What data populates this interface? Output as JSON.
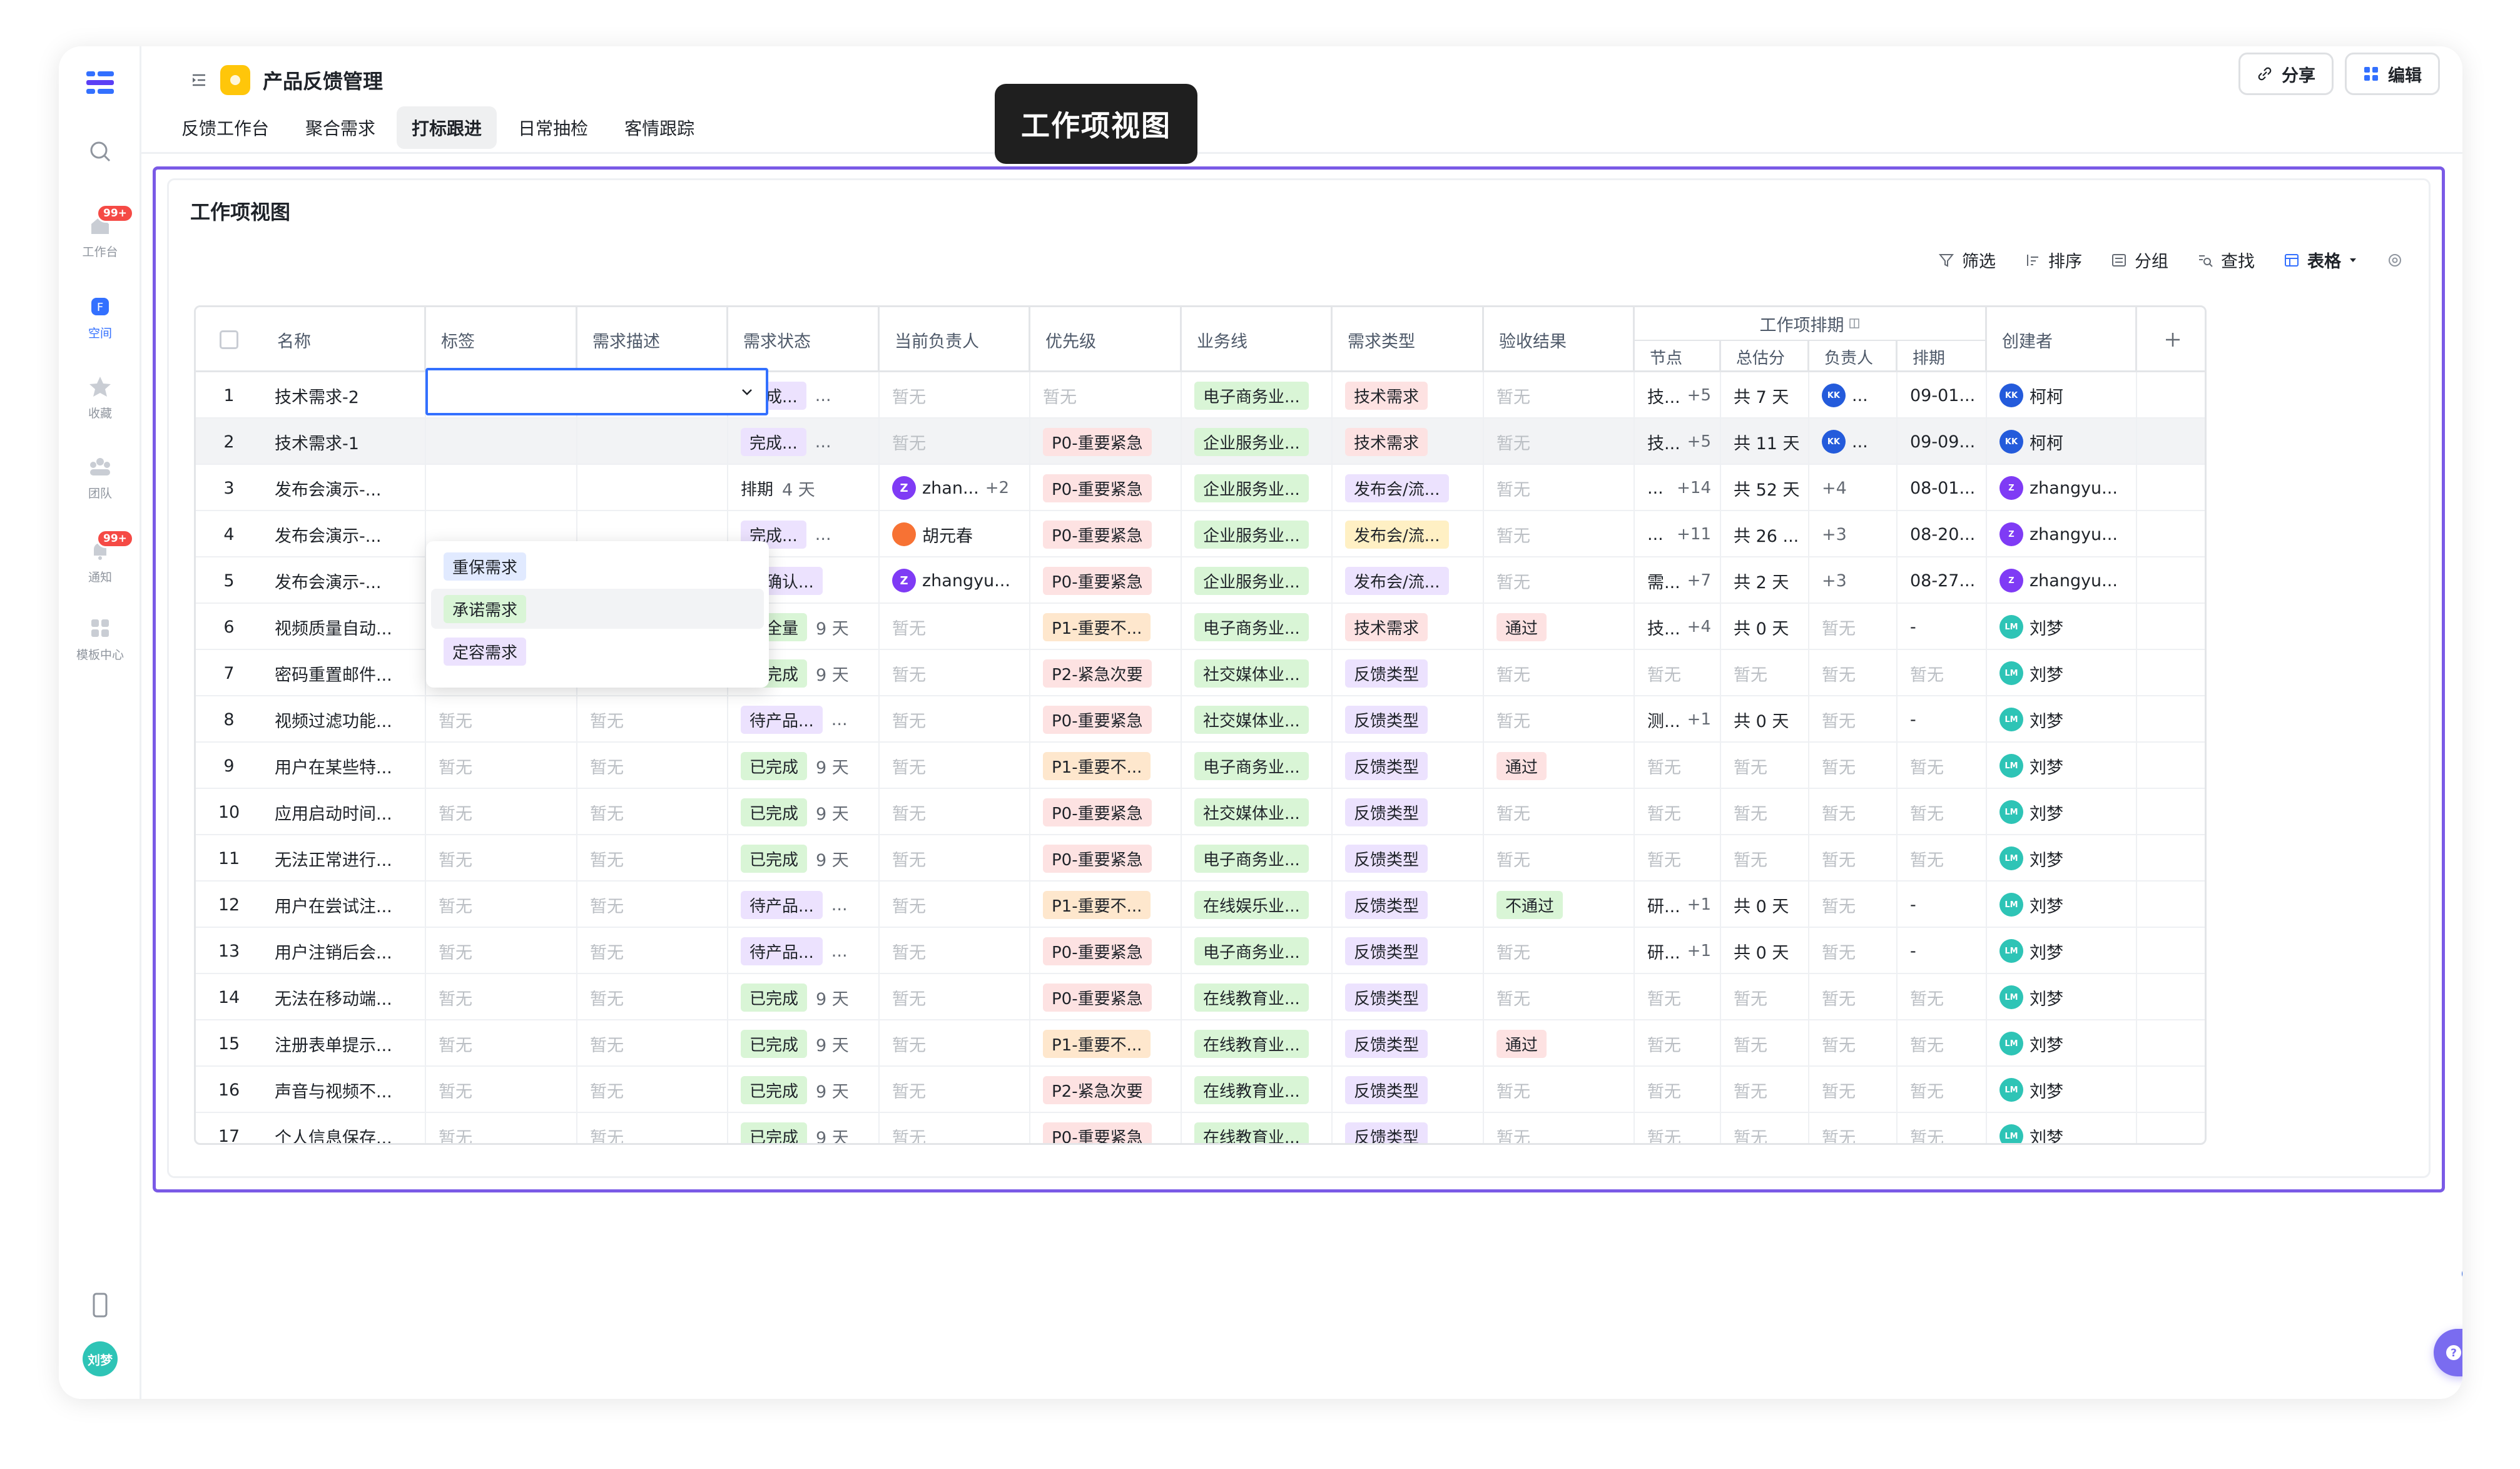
{
  "app": {
    "title": "产品反馈管理",
    "share_label": "分享",
    "edit_label": "编辑",
    "tooltip": "工作项视图",
    "help_label": "帮助"
  },
  "rail": {
    "items": [
      "工作台",
      "空间",
      "收藏",
      "团队",
      "通知",
      "模板中心"
    ],
    "badge": "99+",
    "badge2": "99+",
    "user": "刘梦"
  },
  "tabs": [
    "反馈工作台",
    "聚合需求",
    "打标跟进",
    "日常抽检",
    "客情跟踪"
  ],
  "view": {
    "title": "工作项视图",
    "toolbar": [
      "筛选",
      "排序",
      "分组",
      "查找",
      "表格"
    ]
  },
  "table": {
    "headers": [
      "名称",
      "标签",
      "需求描述",
      "需求状态",
      "当前负责人",
      "优先级",
      "业务线",
      "需求类型",
      "验收结果",
      "工作项排期",
      "创建者"
    ],
    "schedule_sub": [
      "节点",
      "总估分",
      "负责人",
      "排期"
    ],
    "empty": "暂无",
    "rows": [
      {
        "n": "1",
        "name": "技术需求-2",
        "status": "完成...",
        "status_c": "t-purple",
        "days": "...",
        "owner": "暂无",
        "pri": "暂无",
        "line": "电子商务业...",
        "type": "技术需求",
        "type_c": "t-pink",
        "result": "暂无",
        "node": "技...",
        "np": "+5",
        "score": "共 7 天",
        "sowner": "",
        "sdate": "09-01...",
        "creator": "柯柯",
        "ca": "a-blue"
      },
      {
        "n": "2",
        "name": "技术需求-1",
        "status": "完成...",
        "status_c": "t-purple",
        "days": "...",
        "owner": "暂无",
        "pri": "P0-重要紧急",
        "line": "企业服务业...",
        "type": "技术需求",
        "type_c": "t-pink",
        "result": "暂无",
        "node": "技...",
        "np": "+5",
        "score": "共 11 天",
        "sowner": "",
        "sdate": "09-09...",
        "creator": "柯柯",
        "ca": "a-blue"
      },
      {
        "n": "3",
        "name": "发布会演示-...",
        "status": "排期",
        "status_c": "",
        "days": "4 天",
        "owner": "zhan...",
        "op": "+2",
        "pri": "P0-重要紧急",
        "line": "企业服务业...",
        "type": "发布会/流...",
        "type_c": "t-purple",
        "result": "暂无",
        "node": "...",
        "np": "+14",
        "score": "共 52 天",
        "sowner": "+4",
        "sdate": "08-01...",
        "creator": "zhangyu...",
        "ca": "a-purple"
      },
      {
        "n": "4",
        "name": "发布会演示-...",
        "status": "完成...",
        "status_c": "t-purple",
        "days": "...",
        "owner": "胡元春",
        "pri": "P0-重要紧急",
        "line": "企业服务业...",
        "type": "发布会/流...",
        "type_c": "t-yellow",
        "result": "暂无",
        "node": "...",
        "np": "+11",
        "score": "共 26 ...",
        "sowner": "+3",
        "sdate": "08-20...",
        "creator": "zhangyu...",
        "ca": "a-purple"
      },
      {
        "n": "5",
        "name": "发布会演示-...",
        "status": "待确认...",
        "status_c": "t-purple",
        "days": "",
        "owner": "zhangyu...",
        "pri": "P0-重要紧急",
        "line": "企业服务业...",
        "type": "发布会/流...",
        "type_c": "t-purple",
        "result": "暂无",
        "node": "需...",
        "np": "+7",
        "score": "共 2 天",
        "sowner": "+3",
        "sdate": "08-27...",
        "creator": "zhangyu...",
        "ca": "a-purple"
      },
      {
        "n": "6",
        "name": "视频质量自动...",
        "status": "待全量",
        "status_c": "t-green",
        "days": "9 天",
        "owner": "暂无",
        "pri": "P1-重要不...",
        "line": "电子商务业...",
        "type": "技术需求",
        "type_c": "t-pink",
        "result": "通过",
        "node": "技...",
        "np": "+4",
        "score": "共 0 天",
        "sowner": "暂无",
        "sdate": "-",
        "creator": "刘梦",
        "ca": "a-teal"
      },
      {
        "n": "7",
        "name": "密码重置邮件...",
        "status": "已完成",
        "status_c": "t-green",
        "days": "9 天",
        "owner": "暂无",
        "pri": "P2-紧急次要",
        "line": "社交媒体业...",
        "type": "反馈类型",
        "type_c": "t-purple",
        "result": "暂无",
        "node": "暂无",
        "np": "",
        "score": "暂无",
        "sowner": "暂无",
        "sdate": "暂无",
        "creator": "刘梦",
        "ca": "a-teal"
      },
      {
        "n": "8",
        "name": "视频过滤功能...",
        "status": "待产品...",
        "status_c": "t-purple",
        "days": "...",
        "owner": "暂无",
        "pri": "P0-重要紧急",
        "line": "社交媒体业...",
        "type": "反馈类型",
        "type_c": "t-purple",
        "result": "暂无",
        "node": "测...",
        "np": "+1",
        "score": "共 0 天",
        "sowner": "暂无",
        "sdate": "-",
        "creator": "刘梦",
        "ca": "a-teal"
      },
      {
        "n": "9",
        "name": "用户在某些特...",
        "status": "已完成",
        "status_c": "t-green",
        "days": "9 天",
        "owner": "暂无",
        "pri": "P1-重要不...",
        "line": "电子商务业...",
        "type": "反馈类型",
        "type_c": "t-purple",
        "result": "通过",
        "node": "暂无",
        "np": "",
        "score": "暂无",
        "sowner": "暂无",
        "sdate": "暂无",
        "creator": "刘梦",
        "ca": "a-teal"
      },
      {
        "n": "10",
        "name": "应用启动时间...",
        "status": "已完成",
        "status_c": "t-green",
        "days": "9 天",
        "owner": "暂无",
        "pri": "P0-重要紧急",
        "line": "社交媒体业...",
        "type": "反馈类型",
        "type_c": "t-purple",
        "result": "暂无",
        "node": "暂无",
        "np": "",
        "score": "暂无",
        "sowner": "暂无",
        "sdate": "暂无",
        "creator": "刘梦",
        "ca": "a-teal"
      },
      {
        "n": "11",
        "name": "无法正常进行...",
        "status": "已完成",
        "status_c": "t-green",
        "days": "9 天",
        "owner": "暂无",
        "pri": "P0-重要紧急",
        "line": "电子商务业...",
        "type": "反馈类型",
        "type_c": "t-purple",
        "result": "暂无",
        "node": "暂无",
        "np": "",
        "score": "暂无",
        "sowner": "暂无",
        "sdate": "暂无",
        "creator": "刘梦",
        "ca": "a-teal"
      },
      {
        "n": "12",
        "name": "用户在尝试注...",
        "status": "待产品...",
        "status_c": "t-purple",
        "days": "...",
        "owner": "暂无",
        "pri": "P1-重要不...",
        "line": "在线娱乐业...",
        "type": "反馈类型",
        "type_c": "t-purple",
        "result": "不通过",
        "node": "研...",
        "np": "+1",
        "score": "共 0 天",
        "sowner": "暂无",
        "sdate": "-",
        "creator": "刘梦",
        "ca": "a-teal"
      },
      {
        "n": "13",
        "name": "用户注销后会...",
        "status": "待产品...",
        "status_c": "t-purple",
        "days": "...",
        "owner": "暂无",
        "pri": "P0-重要紧急",
        "line": "电子商务业...",
        "type": "反馈类型",
        "type_c": "t-purple",
        "result": "暂无",
        "node": "研...",
        "np": "+1",
        "score": "共 0 天",
        "sowner": "暂无",
        "sdate": "-",
        "creator": "刘梦",
        "ca": "a-teal"
      },
      {
        "n": "14",
        "name": "无法在移动端...",
        "status": "已完成",
        "status_c": "t-green",
        "days": "9 天",
        "owner": "暂无",
        "pri": "P0-重要紧急",
        "line": "在线教育业...",
        "type": "反馈类型",
        "type_c": "t-purple",
        "result": "暂无",
        "node": "暂无",
        "np": "",
        "score": "暂无",
        "sowner": "暂无",
        "sdate": "暂无",
        "creator": "刘梦",
        "ca": "a-teal"
      },
      {
        "n": "15",
        "name": "注册表单提示...",
        "status": "已完成",
        "status_c": "t-green",
        "days": "9 天",
        "owner": "暂无",
        "pri": "P1-重要不...",
        "line": "在线教育业...",
        "type": "反馈类型",
        "type_c": "t-purple",
        "result": "通过",
        "node": "暂无",
        "np": "",
        "score": "暂无",
        "sowner": "暂无",
        "sdate": "暂无",
        "creator": "刘梦",
        "ca": "a-teal"
      },
      {
        "n": "16",
        "name": "声音与视频不...",
        "status": "已完成",
        "status_c": "t-green",
        "days": "9 天",
        "owner": "暂无",
        "pri": "P2-紧急次要",
        "line": "在线教育业...",
        "type": "反馈类型",
        "type_c": "t-purple",
        "result": "暂无",
        "node": "暂无",
        "np": "",
        "score": "暂无",
        "sowner": "暂无",
        "sdate": "暂无",
        "creator": "刘梦",
        "ca": "a-teal"
      },
      {
        "n": "17",
        "name": "个人信息保存...",
        "status": "已完成",
        "status_c": "t-green",
        "days": "9 天",
        "owner": "暂无",
        "pri": "P0-重要紧急",
        "line": "在线教育业...",
        "type": "反馈类型",
        "type_c": "t-purple",
        "result": "暂无",
        "node": "暂无",
        "np": "",
        "score": "暂无",
        "sowner": "暂无",
        "sdate": "暂无",
        "creator": "刘梦",
        "ca": "a-teal"
      }
    ]
  },
  "dropdown": {
    "options": [
      "重保需求",
      "承诺需求",
      "定容需求"
    ]
  }
}
